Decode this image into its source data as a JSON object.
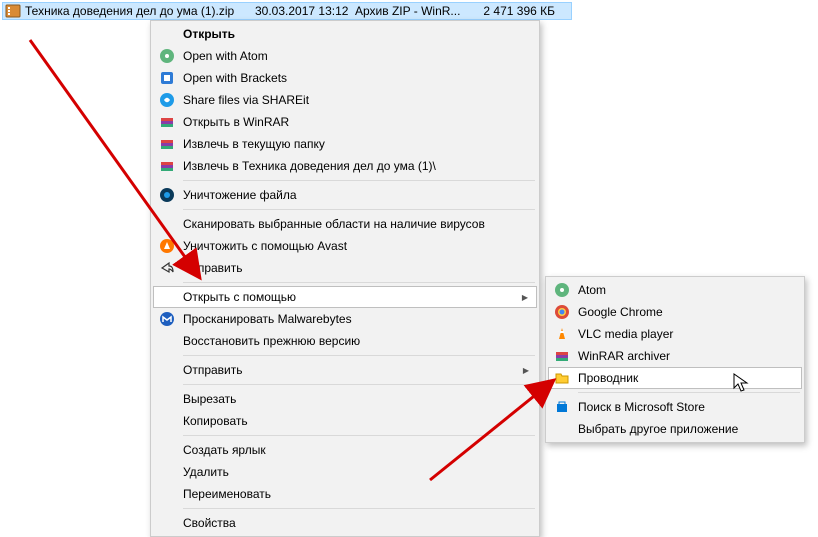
{
  "file_row": {
    "name": "Техника доведения дел до ума (1).zip",
    "date": "30.03.2017 13:12",
    "type": "Архив ZIP - WinR...",
    "size": "2 471 396 КБ"
  },
  "menu1": {
    "open": "Открыть",
    "open_atom": "Open with Atom",
    "open_brackets": "Open with Brackets",
    "share_shareit": "Share files via SHAREit",
    "open_winrar": "Открыть в WinRAR",
    "extract_here": "Извлечь в текущую папку",
    "extract_to": "Извлечь в Техника доведения дел до ума (1)\\",
    "shred": "Уничтожение файла",
    "scan_virus": "Сканировать выбранные области на наличие вирусов",
    "avast_shred": "Уничтожить с помощью Avast",
    "share": "Отправить",
    "open_with": "Открыть с помощью",
    "malwarebytes": "Просканировать Malwarebytes",
    "restore": "Восстановить прежнюю версию",
    "send_to": "Отправить",
    "cut": "Вырезать",
    "copy": "Копировать",
    "shortcut": "Создать ярлык",
    "delete": "Удалить",
    "rename": "Переименовать",
    "properties": "Свойства"
  },
  "menu2": {
    "atom": "Atom",
    "chrome": "Google Chrome",
    "vlc": "VLC media player",
    "winrar": "WinRAR archiver",
    "explorer": "Проводник",
    "store": "Поиск в Microsoft Store",
    "choose": "Выбрать другое приложение"
  }
}
